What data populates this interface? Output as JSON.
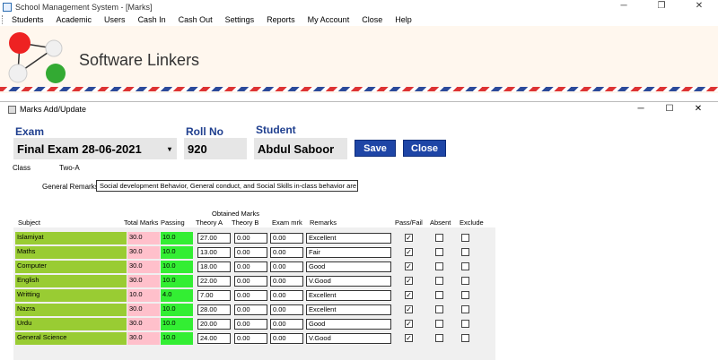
{
  "window": {
    "title": "School Management System - [Marks]",
    "controls": [
      "─",
      "❐",
      "✕"
    ]
  },
  "menu": [
    "Students",
    "Academic",
    "Users",
    "Cash In",
    "Cash Out",
    "Settings",
    "Reports",
    "My Account",
    "Close",
    "Help"
  ],
  "banner": {
    "brand": "Software Linkers"
  },
  "dialog": {
    "title": "Marks Add/Update",
    "controls": [
      "─",
      "☐",
      "✕"
    ]
  },
  "form": {
    "exam_label": "Exam",
    "exam_value": "Final Exam  28-06-2021",
    "rollno_label": "Roll No",
    "rollno_value": "920",
    "student_label": "Student",
    "student_value": "Abdul Saboor",
    "save_label": "Save",
    "close_label": "Close",
    "class_label": "Class",
    "class_value": "Two-A",
    "general_remarks_label": "General Remarks:",
    "general_remarks_value": "Social development Behavior, General conduct, and Social Skills in-class behavior are excellent."
  },
  "table": {
    "headers": {
      "subject": "Subject",
      "total": "Total Marks",
      "passing": "Passing",
      "obtained": "Obtained Marks",
      "theory_a": "Theory A",
      "theory_b": "Theory B",
      "exam_mrk": "Exam mrk",
      "remarks": "Remarks",
      "pass_fail": "Pass/Fail",
      "absent": "Absent",
      "exclude": "Exclude"
    },
    "rows": [
      {
        "subject": "Islamiyat",
        "total": "30.0",
        "passing": "10.0",
        "theory_a": "27.00",
        "theory_b": "0.00",
        "exam_mrk": "0.00",
        "remarks": "Excellent",
        "pass": true,
        "absent": false,
        "exclude": false
      },
      {
        "subject": "Maths",
        "total": "30.0",
        "passing": "10.0",
        "theory_a": "13.00",
        "theory_b": "0.00",
        "exam_mrk": "0.00",
        "remarks": "Fair",
        "pass": true,
        "absent": false,
        "exclude": false
      },
      {
        "subject": "Computer",
        "total": "30.0",
        "passing": "10.0",
        "theory_a": "18.00",
        "theory_b": "0.00",
        "exam_mrk": "0.00",
        "remarks": "Good",
        "pass": true,
        "absent": false,
        "exclude": false
      },
      {
        "subject": "English",
        "total": "30.0",
        "passing": "10.0",
        "theory_a": "22.00",
        "theory_b": "0.00",
        "exam_mrk": "0.00",
        "remarks": "V.Good",
        "pass": true,
        "absent": false,
        "exclude": false
      },
      {
        "subject": "Writting",
        "total": "10.0",
        "passing": "4.0",
        "theory_a": "7.00",
        "theory_b": "0.00",
        "exam_mrk": "0.00",
        "remarks": "Excellent",
        "pass": true,
        "absent": false,
        "exclude": false
      },
      {
        "subject": "Nazra",
        "total": "30.0",
        "passing": "10.0",
        "theory_a": "28.00",
        "theory_b": "0.00",
        "exam_mrk": "0.00",
        "remarks": "Excellent",
        "pass": true,
        "absent": false,
        "exclude": false
      },
      {
        "subject": "Urdu",
        "total": "30.0",
        "passing": "10.0",
        "theory_a": "20.00",
        "theory_b": "0.00",
        "exam_mrk": "0.00",
        "remarks": "Good",
        "pass": true,
        "absent": false,
        "exclude": false
      },
      {
        "subject": "General Science",
        "total": "30.0",
        "passing": "10.0",
        "theory_a": "24.00",
        "theory_b": "0.00",
        "exam_mrk": "0.00",
        "remarks": "V.Good",
        "pass": true,
        "absent": false,
        "exclude": false
      }
    ]
  },
  "colors": {
    "accent_blue": "#1e45a6",
    "label_blue": "#1f3f8f",
    "subject_green": "#99cc33",
    "total_pink": "#ffc0cb",
    "passing_green": "#33ee33"
  }
}
